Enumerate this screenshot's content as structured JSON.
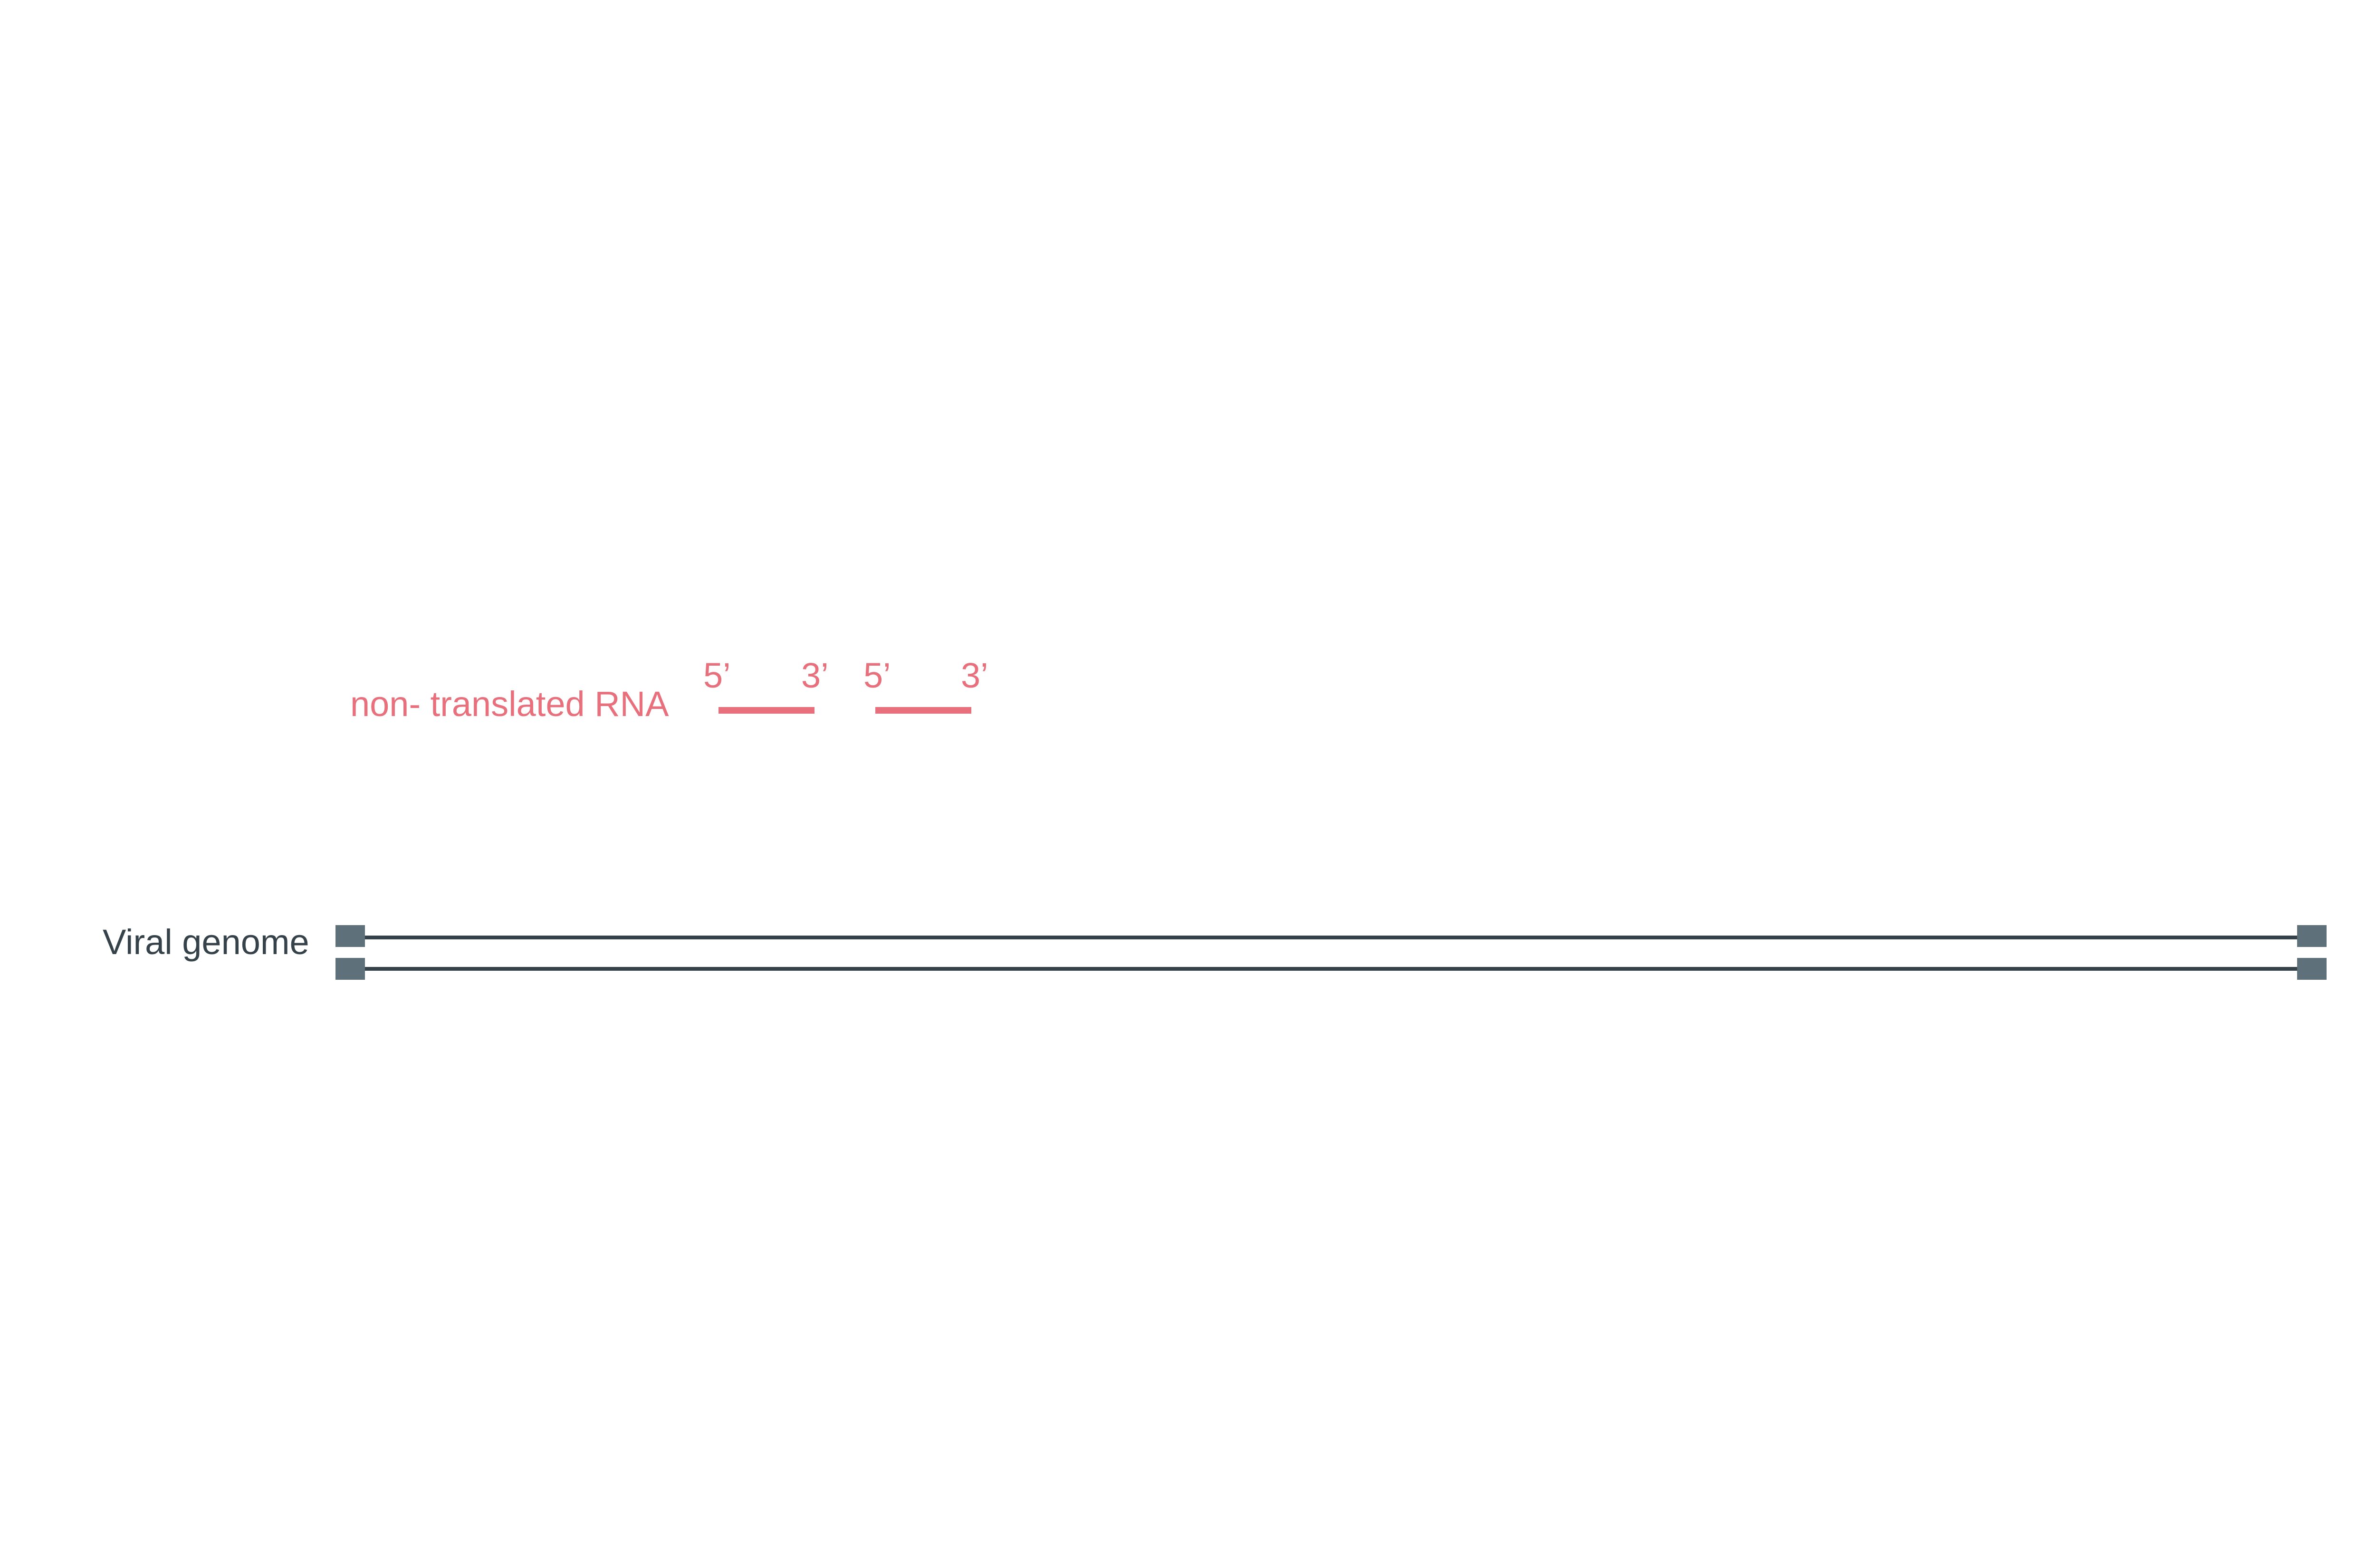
{
  "genome": {
    "label": "Viral genome",
    "line_color": "#36424a",
    "cap_color": "#5e707a"
  },
  "ntrna": {
    "label": "non- translated RNA",
    "color": "#e8707c",
    "fragments": [
      {
        "five_prime": "5’",
        "three_prime": "3’"
      },
      {
        "five_prime": "5’",
        "three_prime": "3’"
      }
    ]
  }
}
